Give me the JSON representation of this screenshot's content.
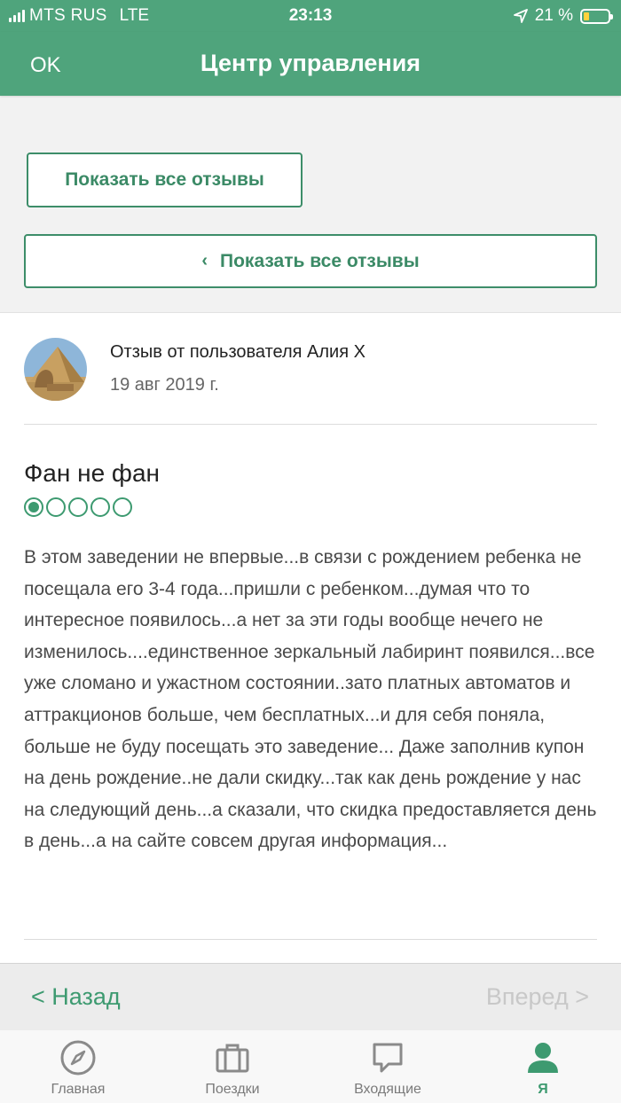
{
  "status_bar": {
    "carrier": "MTS RUS",
    "network": "LTE",
    "time": "23:13",
    "battery_percent": "21 %"
  },
  "navbar": {
    "ok_label": "OK",
    "title": "Центр управления"
  },
  "buttons": {
    "show_all_reviews_1": "Показать все отзывы",
    "show_all_reviews_2": "Показать все отзывы",
    "chevron": "‹"
  },
  "review": {
    "author_line": "Отзыв от пользователя Алия Х",
    "date": "19 авг 2019 г.",
    "title": "Фан не фан",
    "rating": 1,
    "rating_max": 5,
    "text": "В этом заведении не впервые...в связи с рождением ребенка не посещала его 3-4 года...пришли с ребенком...думая что то интересное появилось...а нет за эти годы вообще нечего не изменилось....единственное зеркальный лабиринт появился...все уже сломано и ужастном состоянии..зато платных автоматов и аттракционов больше, чем бесплатных...и для себя поняла, больше не буду посещать это заведение... Даже заполнив купон на день рождение..не дали скидку...так как день рождение у нас на следующий день...а сказали, что скидка предоставляется день в день...а на сайте совсем другая информация..."
  },
  "pager": {
    "back_label": "< Назад",
    "forward_label": "Вперед >"
  },
  "tabbar": {
    "items": [
      {
        "label": "Главная",
        "icon": "compass-icon"
      },
      {
        "label": "Поездки",
        "icon": "suitcase-icon"
      },
      {
        "label": "Входящие",
        "icon": "chat-bubble-icon"
      },
      {
        "label": "Я",
        "icon": "profile-icon"
      }
    ],
    "active_index": 3
  },
  "colors": {
    "brand_green": "#4fa47c",
    "accent_green": "#3d9a70",
    "battery_yellow": "#ffd23c"
  }
}
